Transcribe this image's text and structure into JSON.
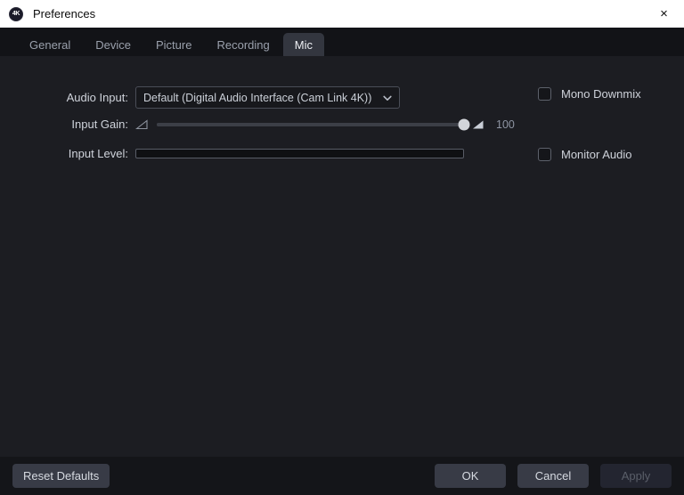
{
  "window": {
    "title": "Preferences",
    "icon": "app-4k-icon",
    "icon_text": "4K",
    "close_icon": "close-icon",
    "close_glyph": "×"
  },
  "tabs": [
    {
      "label": "General",
      "active": false
    },
    {
      "label": "Device",
      "active": false
    },
    {
      "label": "Picture",
      "active": false
    },
    {
      "label": "Recording",
      "active": false
    },
    {
      "label": "Mic",
      "active": true
    }
  ],
  "form": {
    "audio_input": {
      "label": "Audio Input:",
      "value": "Default (Digital Audio Interface (Cam Link 4K))",
      "chevron_icon": "chevron-down-icon"
    },
    "input_gain": {
      "label": "Input Gain:",
      "value": "100",
      "percent": 100,
      "min_icon": "volume-low-icon",
      "max_icon": "volume-high-icon"
    },
    "input_level": {
      "label": "Input Level:",
      "level_percent": 0
    }
  },
  "options": [
    {
      "label": "Mono Downmix",
      "checked": false
    },
    {
      "label": "Monitor Audio",
      "checked": false
    }
  ],
  "footer": {
    "reset_label": "Reset Defaults",
    "ok_label": "OK",
    "cancel_label": "Cancel",
    "apply_label": "Apply",
    "apply_disabled": true
  },
  "colors": {
    "window_bg": "#1c1d22",
    "titlebar_bg": "#ffffff",
    "tabbar_bg": "#121317",
    "active_tab_bg": "#33363f",
    "footer_bg": "#141519",
    "button_bg": "#383b46",
    "button_disabled_bg": "#232530",
    "text": "#cfd3db",
    "slider_handle": "#d2d5da"
  }
}
